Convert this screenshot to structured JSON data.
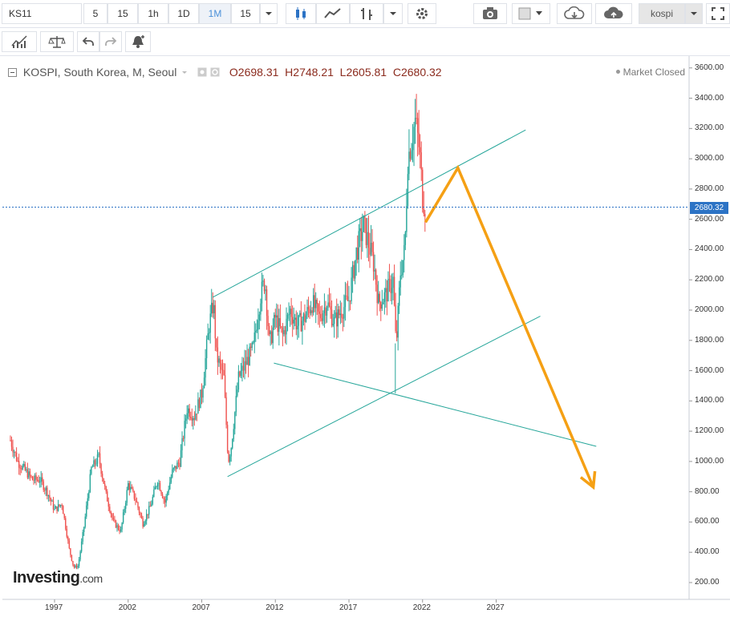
{
  "toolbar": {
    "symbol": "KS11",
    "intervals": [
      "5",
      "15",
      "1h",
      "1D",
      "1M",
      "15"
    ],
    "active_interval": "1M",
    "search_value": "kospi",
    "icons": [
      "candles-icon",
      "line-chart-icon",
      "bars-icon",
      "dropdown-icon",
      "gear-icon",
      "camera-icon",
      "color-square-icon",
      "cloud-download-icon",
      "cloud-upload-icon",
      "fullscreen-icon"
    ]
  },
  "toolbar2": {
    "icons": [
      "indicators-icon",
      "compare-scale-icon",
      "undo-icon",
      "redo-icon",
      "alert-icon"
    ]
  },
  "legend": {
    "title": "KOSPI, South Korea, M, Seoul",
    "open": "O2698.31",
    "high": "H2748.21",
    "low": "L2605.81",
    "close": "C2680.32",
    "status": "Market Closed",
    "last_price_tag": "2680.32"
  },
  "logo": {
    "main": "Investing",
    "suffix": ".com"
  },
  "chart_data": {
    "type": "candlestick",
    "title": "KOSPI, South Korea, M, Seoul",
    "interval": "M",
    "x_axis": {
      "tick_labels": [
        "1997",
        "2002",
        "2007",
        "2012",
        "2017",
        "2022",
        "2027"
      ]
    },
    "y_axis": {
      "tick_labels": [
        "200.00",
        "400.00",
        "600.00",
        "800.00",
        "1000.00",
        "1200.00",
        "1400.00",
        "1600.00",
        "1800.00",
        "2000.00",
        "2200.00",
        "2400.00",
        "2600.00",
        "2800.00",
        "3000.00",
        "3200.00",
        "3400.00",
        "3600.00"
      ],
      "range": [
        100,
        3700
      ]
    },
    "last_close": 2680.32,
    "price_series": [
      [
        1994.0,
        1140
      ],
      [
        1994.5,
        1000
      ],
      [
        1995.0,
        940
      ],
      [
        1995.5,
        880
      ],
      [
        1996.0,
        880
      ],
      [
        1996.5,
        800
      ],
      [
        1997.0,
        680
      ],
      [
        1997.5,
        720
      ],
      [
        1998.0,
        420
      ],
      [
        1998.3,
        300
      ],
      [
        1998.6,
        310
      ],
      [
        1999.0,
        570
      ],
      [
        1999.5,
        950
      ],
      [
        2000.0,
        1030
      ],
      [
        2000.5,
        780
      ],
      [
        2001.0,
        600
      ],
      [
        2001.5,
        540
      ],
      [
        2002.0,
        850
      ],
      [
        2002.5,
        750
      ],
      [
        2003.0,
        590
      ],
      [
        2003.5,
        700
      ],
      [
        2004.0,
        880
      ],
      [
        2004.5,
        730
      ],
      [
        2005.0,
        930
      ],
      [
        2005.5,
        1000
      ],
      [
        2006.0,
        1350
      ],
      [
        2006.5,
        1300
      ],
      [
        2007.0,
        1450
      ],
      [
        2007.5,
        1900
      ],
      [
        2007.8,
        2050
      ],
      [
        2008.0,
        1700
      ],
      [
        2008.5,
        1550
      ],
      [
        2008.8,
        1000
      ],
      [
        2009.0,
        1100
      ],
      [
        2009.5,
        1550
      ],
      [
        2010.0,
        1650
      ],
      [
        2010.5,
        1750
      ],
      [
        2011.0,
        2100
      ],
      [
        2011.3,
        2200
      ],
      [
        2011.6,
        1770
      ],
      [
        2012.0,
        1950
      ],
      [
        2012.5,
        1830
      ],
      [
        2013.0,
        2000
      ],
      [
        2013.5,
        1900
      ],
      [
        2014.0,
        1950
      ],
      [
        2014.5,
        2050
      ],
      [
        2015.0,
        1950
      ],
      [
        2015.5,
        2050
      ],
      [
        2016.0,
        1920
      ],
      [
        2016.5,
        2000
      ],
      [
        2017.0,
        2070
      ],
      [
        2017.5,
        2380
      ],
      [
        2018.0,
        2560
      ],
      [
        2018.3,
        2450
      ],
      [
        2018.7,
        2300
      ],
      [
        2019.0,
        2050
      ],
      [
        2019.5,
        2100
      ],
      [
        2020.0,
        2200
      ],
      [
        2020.2,
        1750
      ],
      [
        2020.5,
        2250
      ],
      [
        2020.8,
        2400
      ],
      [
        2021.0,
        3000
      ],
      [
        2021.5,
        3250
      ],
      [
        2021.8,
        3050
      ],
      [
        2022.0,
        2750
      ],
      [
        2022.2,
        2680.32
      ]
    ],
    "trendlines": [
      {
        "name": "upper-channel",
        "points": [
          [
            2007.75,
            2085
          ],
          [
            2029.0,
            3190
          ]
        ]
      },
      {
        "name": "lower-channel",
        "points": [
          [
            2008.75,
            900
          ],
          [
            2030.0,
            1960
          ]
        ]
      },
      {
        "name": "falling-line",
        "points": [
          [
            2011.9,
            1650
          ],
          [
            2033.8,
            1100
          ]
        ]
      },
      {
        "name": "vertical-marker-low",
        "points": [
          [
            2020.15,
            1450
          ],
          [
            2020.15,
            1780
          ]
        ]
      }
    ],
    "forecast_arrow": {
      "points": [
        [
          2022.2,
          2580
        ],
        [
          2024.4,
          2940
        ],
        [
          2033.6,
          830
        ]
      ],
      "color": "#f5a014"
    },
    "channel_color": "#26a69a",
    "colors": {
      "up": "#26a69a",
      "down": "#ef5350",
      "price_line": "#2c73c5"
    }
  }
}
